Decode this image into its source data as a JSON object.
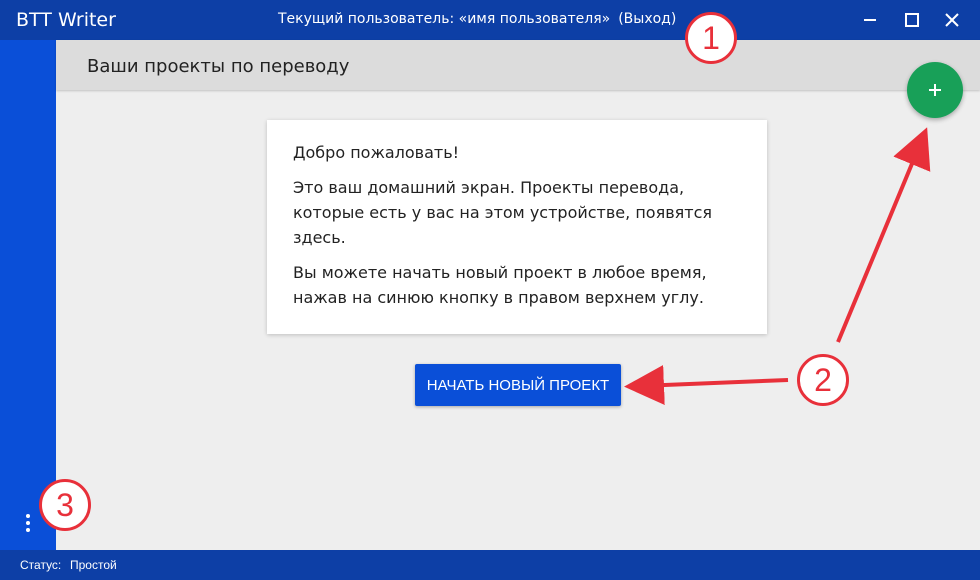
{
  "titlebar": {
    "app_name": "BTT Writer",
    "user_label": "Текущий пользователь: «имя пользователя»",
    "logout_label": "(Выход)"
  },
  "header": {
    "title": "Ваши проекты по переводу"
  },
  "welcome_card": {
    "heading": "Добро пожаловать!",
    "paragraph1": "Это ваш домашний экран. Проекты перевода, которые есть у вас на этом устройстве, появятся здесь.",
    "paragraph2": "Вы можете начать новый проект в любое время, нажав на синюю кнопку в правом верхнем углу."
  },
  "start_button": {
    "label": "Начать новый проект"
  },
  "statusbar": {
    "label": "Статус:",
    "value": "Простой"
  },
  "annotations": {
    "one": "1",
    "two": "2",
    "three": "3"
  },
  "colors": {
    "titlebar": "#0d3fa6",
    "sidebar": "#0a4fd8",
    "fab": "#18a058",
    "annotation": "#e8303a"
  },
  "icons": {
    "minimize": "minimize-icon",
    "maximize": "maximize-icon",
    "close": "close-icon",
    "add": "plus-icon",
    "menu": "more-vertical-icon"
  }
}
